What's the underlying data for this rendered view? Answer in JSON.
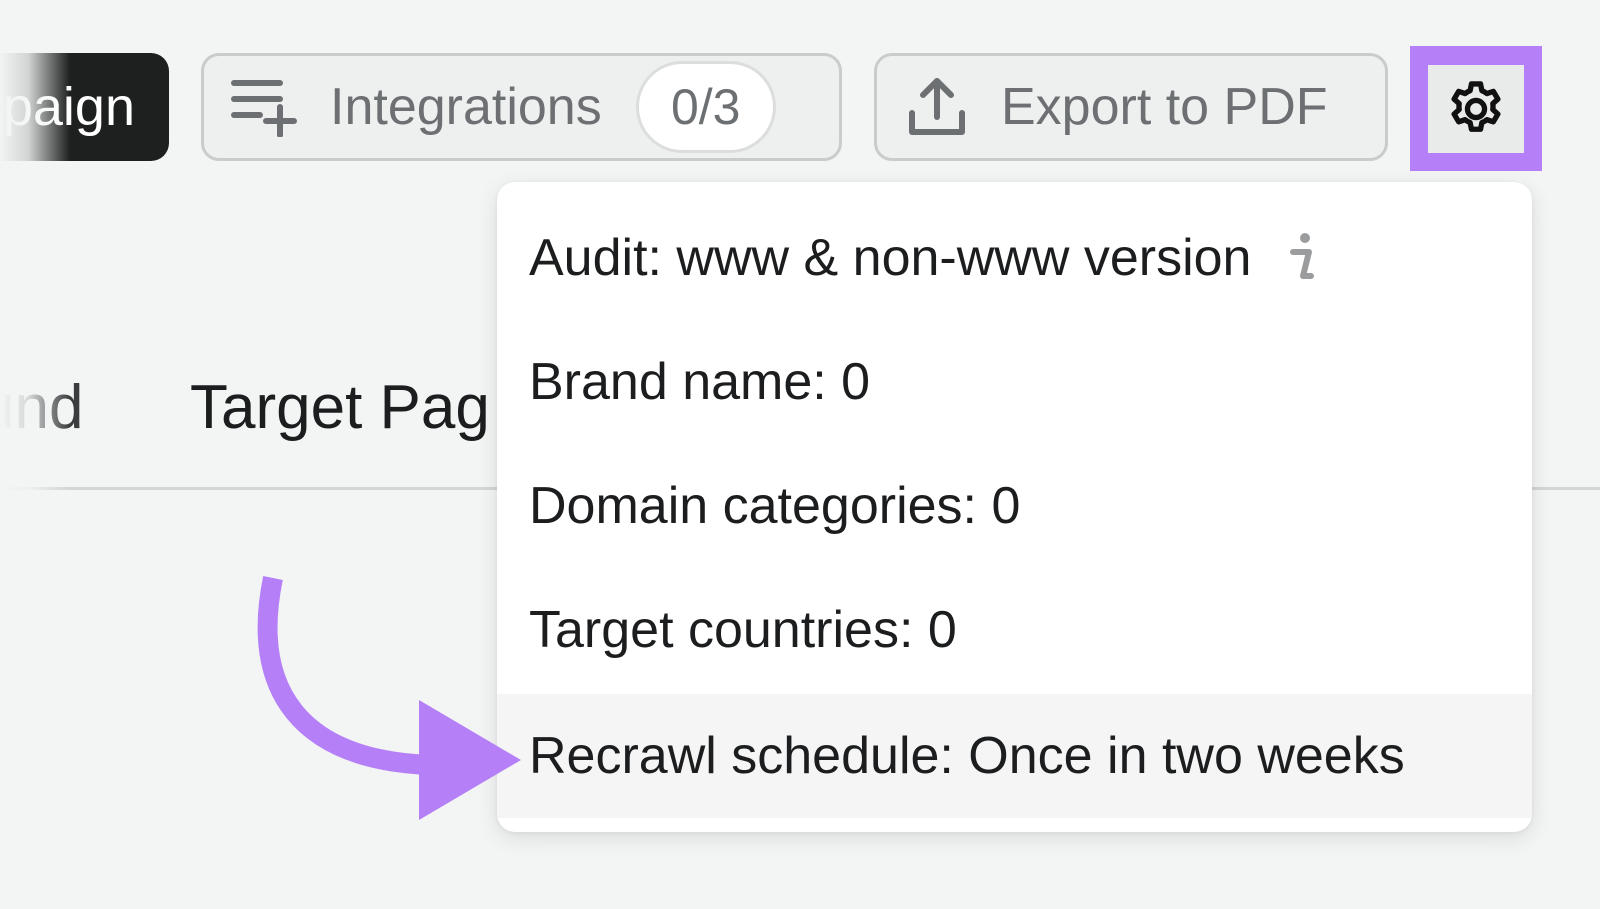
{
  "toolbar": {
    "campaign_label": "paign",
    "integrations_label": "Integrations",
    "integrations_count": "0/3",
    "export_label": "Export to PDF"
  },
  "tabs": {
    "prev_partial": "und",
    "target_partial": "Target Pag"
  },
  "settings_menu": {
    "items": [
      {
        "label": "Audit: www & non-www version"
      },
      {
        "label": "Brand name: 0"
      },
      {
        "label": "Domain categories: 0"
      },
      {
        "label": "Target countries: 0"
      },
      {
        "label": "Recrawl schedule: Once in two weeks"
      }
    ]
  },
  "icons": {
    "integrations": "playlist-add-icon",
    "export": "upload-icon",
    "settings": "gear-icon",
    "info": "info-icon"
  },
  "colors": {
    "highlight": "#b57ff7",
    "primary_button": "#1e201f",
    "background": "#f3f4f4"
  }
}
